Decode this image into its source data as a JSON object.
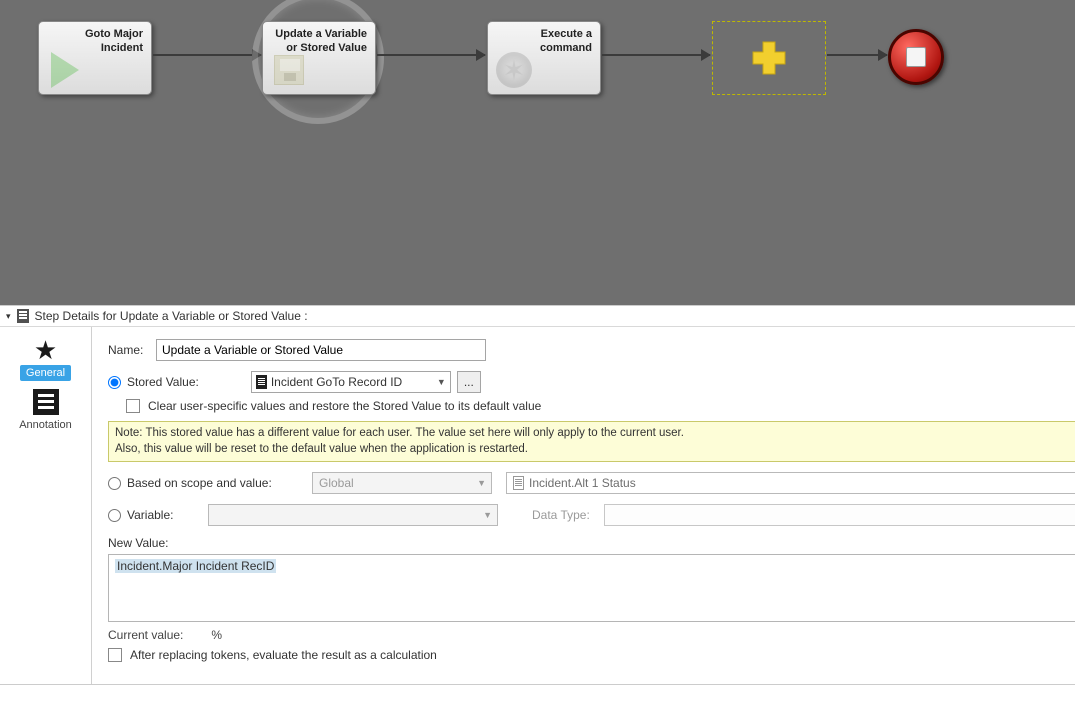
{
  "flow": {
    "steps": [
      {
        "label": "Goto Major Incident"
      },
      {
        "label": "Update a Variable or Stored Value"
      },
      {
        "label": "Execute a command"
      }
    ]
  },
  "header": {
    "title": "Step Details for Update a Variable or Stored Value :"
  },
  "tabs": {
    "general": "General",
    "annotation": "Annotation"
  },
  "form": {
    "name_label": "Name:",
    "name_value": "Update a Variable or Stored Value",
    "stored_value_label": "Stored Value:",
    "stored_value_selected": "Incident GoTo Record ID",
    "ellipsis": "...",
    "clear_checkbox": "Clear user-specific values and restore the Stored Value to its default value",
    "note_line1": "Note: This stored value has a different value for each user.  The value set here will only apply to the current user.",
    "note_line2": "Also, this value will be reset to the default value when the application is restarted.",
    "scope_label": "Based on scope and value:",
    "scope_value": "Global",
    "scope_field_value": "Incident.Alt 1 Status",
    "variable_label": "Variable:",
    "datatype_label": "Data Type:",
    "new_value_label": "New Value:",
    "new_value_text": "Incident.Major Incident RecID",
    "current_value_label": "Current value:",
    "current_value_text": "%",
    "after_checkbox": "After replacing tokens, evaluate the result as a calculation"
  }
}
